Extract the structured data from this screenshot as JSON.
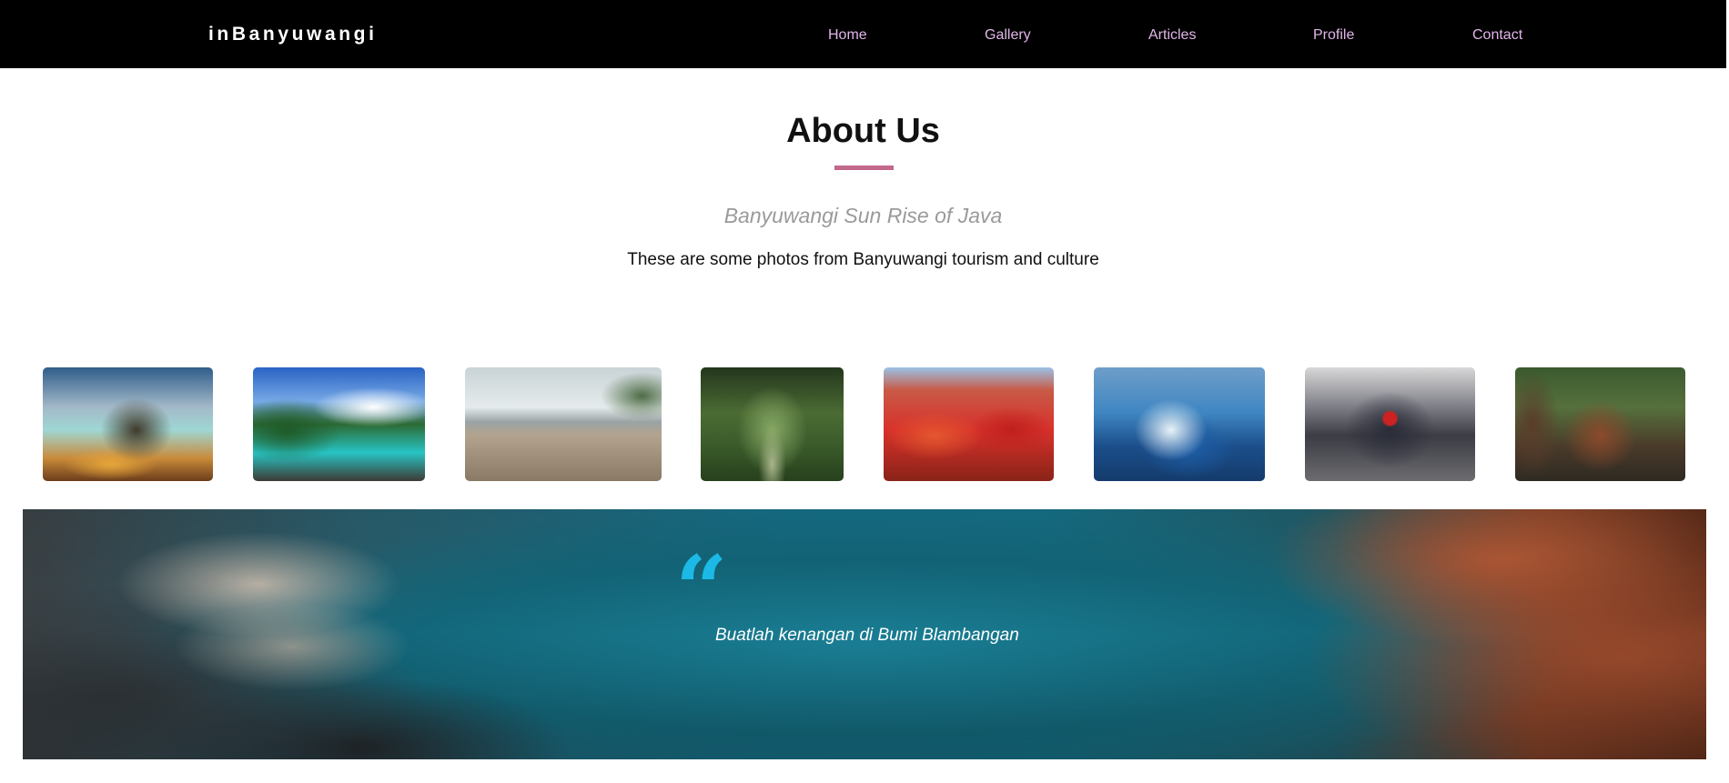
{
  "navbar": {
    "brand": "inBanyuwangi",
    "links": [
      {
        "label": "Home"
      },
      {
        "label": "Gallery"
      },
      {
        "label": "Articles"
      },
      {
        "label": "Profile"
      },
      {
        "label": "Contact"
      }
    ],
    "link_color": "#e2b6ea",
    "background": "#000000"
  },
  "about": {
    "title": "About Us",
    "accent_color": "#c2688a",
    "subtitle": "Banyuwangi Sun Rise of Java",
    "description": "These are some photos from Banyuwangi tourism and culture"
  },
  "gallery": {
    "thumbnails": [
      {
        "subject": "rocky-beach-photo"
      },
      {
        "subject": "turquoise-bay-photo"
      },
      {
        "subject": "turtle-beach-photo"
      },
      {
        "subject": "tree-tunnel-photo"
      },
      {
        "subject": "dancers-festival-photo"
      },
      {
        "subject": "surfing-wave-photo"
      },
      {
        "subject": "barong-mask-photo"
      },
      {
        "subject": "temple-forest-photo"
      }
    ]
  },
  "quote_banner": {
    "quote": "Buatlah kenangan di Bumi Blambangan",
    "quote_mark": "“",
    "quote_mark_color": "#1cb8e6",
    "background_subject": "ijen-crater-lake-photo"
  }
}
